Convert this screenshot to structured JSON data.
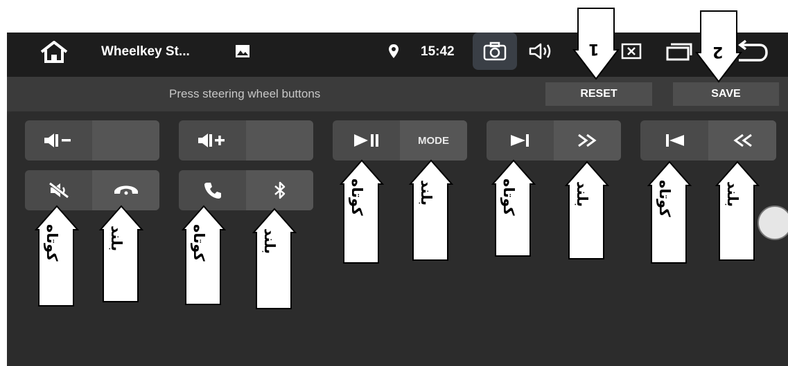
{
  "status_bar": {
    "app_title": "Wheelkey St...",
    "time": "15:42",
    "icons": [
      "home-icon",
      "image-icon",
      "location-icon",
      "camera-icon",
      "volume-icon",
      "close-window-icon",
      "recent-apps-icon",
      "back-icon"
    ]
  },
  "toolbar": {
    "hint": "Press steering wheel buttons",
    "reset_label": "RESET",
    "save_label": "SAVE"
  },
  "buttons": {
    "vol_down": "volume-down-icon",
    "vol_up": "volume-up-icon",
    "play_pause": "play-pause-icon",
    "mode_label": "MODE",
    "next": "next-track-icon",
    "fast_forward": "fast-forward-icon",
    "prev": "previous-track-icon",
    "rewind": "rewind-icon",
    "mute": "mute-icon",
    "hangup": "hang-up-icon",
    "call": "call-icon",
    "bluetooth": "bluetooth-icon"
  },
  "callouts": {
    "one": "1",
    "two": "2",
    "short": "کوتاه",
    "long": "بلند"
  }
}
